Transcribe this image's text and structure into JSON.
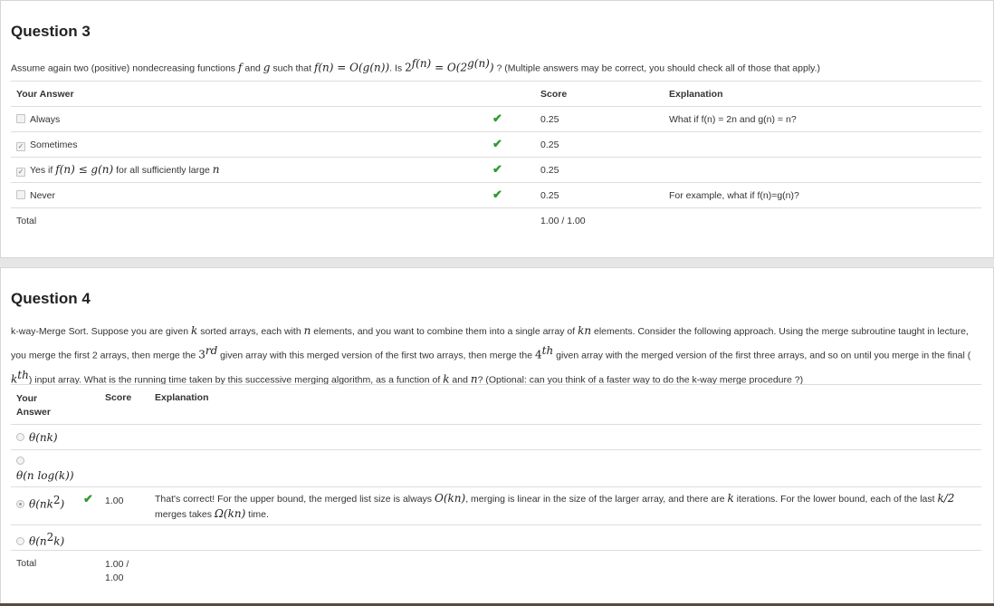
{
  "q3": {
    "title": "Question 3",
    "prompt": {
      "p1": "Assume again two (positive) nondecreasing functions ",
      "f": "f",
      "and": " and ",
      "g": "g",
      "such": " such that ",
      "cond": "f(n) = O(g(n))",
      "is": ". Is ",
      "q_base": "2",
      "q_exp1": "f(n)",
      "q_mid": " = O(2",
      "q_exp2": "g(n)",
      "q_end": ")",
      "p2": " ? (Multiple answers may be correct, you should check all of those that apply.)"
    },
    "headers": {
      "answer": "Your Answer",
      "score": "Score",
      "explanation": "Explanation"
    },
    "rows": [
      {
        "answer": "Always",
        "score": "0.25",
        "explanation": "What if f(n) = 2n and g(n) = n?"
      },
      {
        "answer": "Sometimes",
        "score": "0.25",
        "explanation": ""
      },
      {
        "answer_pre": "Yes if ",
        "answer_math": "f(n) ≤ g(n)",
        "answer_post": " for all sufficiently large ",
        "answer_n": "n",
        "score": "0.25",
        "explanation": ""
      },
      {
        "answer": "Never",
        "score": "0.25",
        "explanation": "For example, what if f(n)=g(n)?"
      }
    ],
    "total_label": "Total",
    "total_score": "1.00 / 1.00"
  },
  "q4": {
    "title": "Question 4",
    "prompt": {
      "l1a": "k-way-Merge Sort. Suppose you are given ",
      "k": "k",
      "l1b": " sorted arrays, each with ",
      "n": "n",
      "l1c": " elements, and you want to combine them into a single array of ",
      "kn": "kn",
      "l1d": " elements. Consider the following approach. Using the merge subroutine taught in lecture,",
      "l2a": "you merge the first 2 arrays, then merge the ",
      "third": "3",
      "rd": "rd",
      "l2b": " given array with this merged version of the first two arrays, then merge the ",
      "fourth": "4",
      "th": "th",
      "l2c": " given array with the merged version of the first three arrays, and so on until you merge in the final (",
      "kth": "k",
      "kth_sup": "th",
      "l3a": ") input array. What is the running time taken by this successive merging algorithm, as a function of ",
      "l3_and": " and ",
      "l3b": "? (Optional: can you think of a faster way to do the k-way merge procedure ?)"
    },
    "headers": {
      "answer1": "Your",
      "answer2": "Answer",
      "score": "Score",
      "explanation": "Explanation"
    },
    "options": [
      {
        "math": "θ(nk)"
      },
      {
        "math": "θ(n log(k))"
      },
      {
        "math_base": "θ(nk",
        "math_sup": "2",
        "math_end": ")",
        "score": "1.00"
      },
      {
        "math_base": "θ(n",
        "math_sup": "2",
        "math_end": "k)"
      }
    ],
    "explanation": {
      "a": "That's correct! For the upper bound, the merged list size is always ",
      "b": "O(kn)",
      "c": ", merging is linear in the size of the larger array, and there are ",
      "d": "k",
      "e": " iterations. For the lower bound, each of the last ",
      "f": "k/2",
      "g": "merges takes ",
      "h": "Ω(kn)",
      "i": " time."
    },
    "total_label": "Total",
    "total_score1": "1.00 /",
    "total_score2": "1.00"
  },
  "icons": {
    "check": "check-icon",
    "checkbox": "checkbox-icon",
    "radio": "radio-icon"
  },
  "colors": {
    "check": "#2e9a2e",
    "border": "#d6d6d6",
    "background": "#e6e6e6"
  }
}
